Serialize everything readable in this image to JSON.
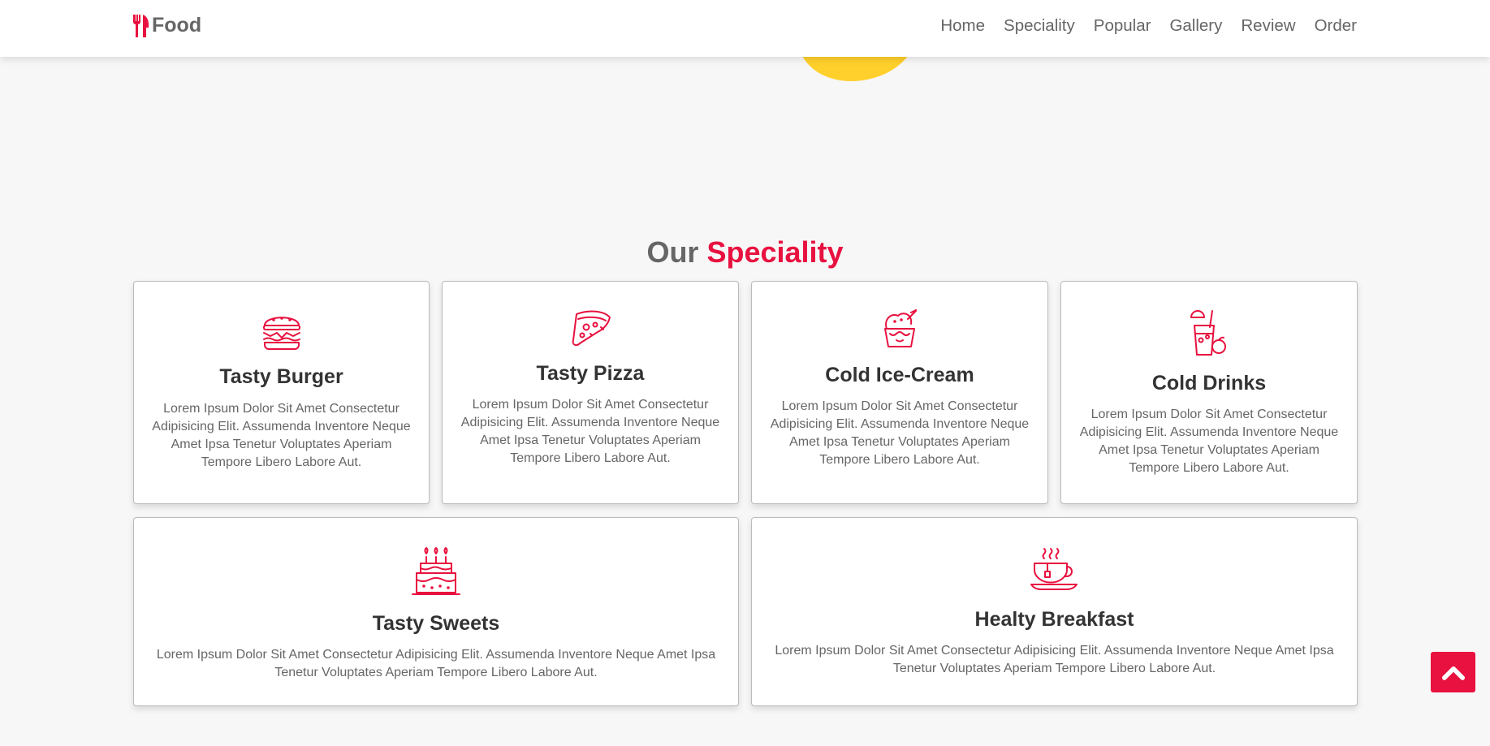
{
  "header": {
    "logo_text": "Food",
    "nav": [
      "Home",
      "Speciality",
      "Popular",
      "Gallery",
      "Review",
      "Order"
    ]
  },
  "section": {
    "title_plain": "Our ",
    "title_accent": "Speciality"
  },
  "cards": [
    {
      "icon": "burger-icon",
      "title": "Tasty Burger",
      "text": "Lorem Ipsum Dolor Sit Amet Consectetur Adipisicing Elit. Assumenda Inventore Neque Amet Ipsa Tenetur Voluptates Aperiam Tempore Libero Labore Aut."
    },
    {
      "icon": "pizza-icon",
      "title": "Tasty Pizza",
      "text": "Lorem Ipsum Dolor Sit Amet Consectetur Adipisicing Elit. Assumenda Inventore Neque Amet Ipsa Tenetur Voluptates Aperiam Tempore Libero Labore Aut."
    },
    {
      "icon": "ice-cream-icon",
      "title": "Cold Ice-Cream",
      "text": "Lorem Ipsum Dolor Sit Amet Consectetur Adipisicing Elit. Assumenda Inventore Neque Amet Ipsa Tenetur Voluptates Aperiam Tempore Libero Labore Aut."
    },
    {
      "icon": "drink-icon",
      "title": "Cold Drinks",
      "text": "Lorem Ipsum Dolor Sit Amet Consectetur Adipisicing Elit. Assumenda Inventore Neque Amet Ipsa Tenetur Voluptates Aperiam Tempore Libero Labore Aut."
    },
    {
      "icon": "cake-icon",
      "title": "Tasty Sweets",
      "text": "Lorem Ipsum Dolor Sit Amet Consectetur Adipisicing Elit. Assumenda Inventore Neque Amet Ipsa Tenetur Voluptates Aperiam Tempore Libero Labore Aut."
    },
    {
      "icon": "teacup-icon",
      "title": "Healty Breakfast",
      "text": "Lorem Ipsum Dolor Sit Amet Consectetur Adipisicing Elit. Assumenda Inventore Neque Amet Ipsa Tenetur Voluptates Aperiam Tempore Libero Labore Aut."
    }
  ],
  "colors": {
    "accent": "#e8113f",
    "blob": "#ffd02b",
    "background": "#f7f7f7"
  },
  "scroll_top_icon": "chevron-up-icon"
}
